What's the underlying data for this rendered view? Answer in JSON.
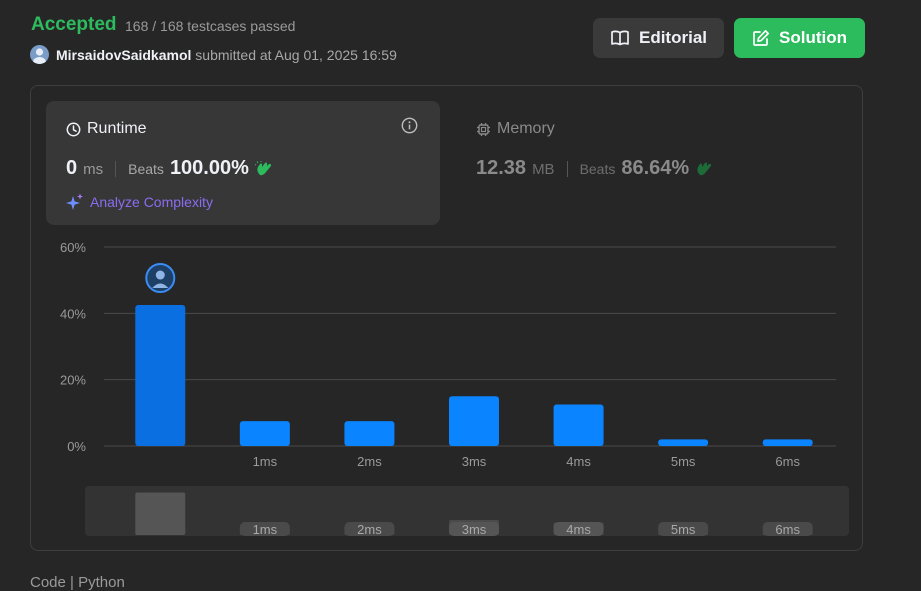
{
  "header": {
    "status": "Accepted",
    "testcases": "168 / 168 testcases passed",
    "username": "MirsaidovSaidkamol",
    "submitted_text": "submitted at Aug 01, 2025 16:59",
    "editorial_label": "Editorial",
    "solution_label": "Solution"
  },
  "runtime": {
    "title": "Runtime",
    "value": "0",
    "unit": "ms",
    "beats_label": "Beats",
    "beats_value": "100.00%",
    "analyze_label": "Analyze Complexity"
  },
  "memory": {
    "title": "Memory",
    "value": "12.38",
    "unit": "MB",
    "beats_label": "Beats",
    "beats_value": "86.64%"
  },
  "colors": {
    "accent_green": "#2cbb5d",
    "bar_blue": "#0a84ff",
    "analyze_purple": "#8b6cf0",
    "background": "#262626"
  },
  "chart_data": {
    "type": "bar",
    "categories": [
      "",
      "1ms",
      "2ms",
      "3ms",
      "4ms",
      "5ms",
      "6ms"
    ],
    "values": [
      42.5,
      7.5,
      7.5,
      15,
      12.5,
      2,
      2
    ],
    "yticks": [
      "60%",
      "40%",
      "20%",
      "0%"
    ],
    "ylim": [
      0,
      60
    ],
    "grid": true,
    "highlight_index": 0,
    "range_labels": [
      "1ms",
      "2ms",
      "3ms",
      "4ms",
      "5ms",
      "6ms"
    ]
  },
  "footer": {
    "partial_text": "Code | Python"
  }
}
